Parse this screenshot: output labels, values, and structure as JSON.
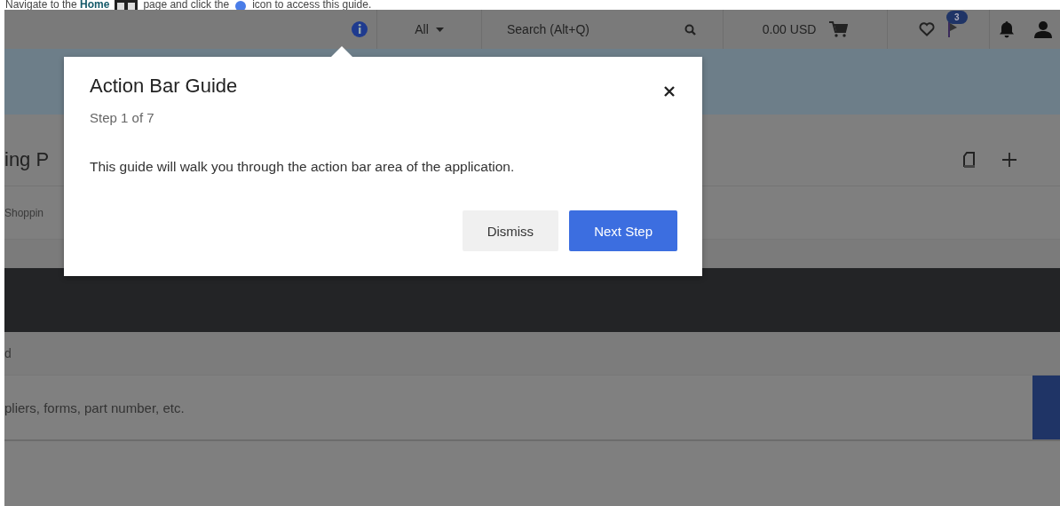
{
  "instruction": {
    "before": "Navigate to the **Home**",
    "middle": "page and click the",
    "after": "icon to access this guide."
  },
  "top_bar": {
    "scope": "All",
    "search_placeholder": "Search (Alt+Q)",
    "cart_total": "0.00 USD",
    "flag_badge": "3"
  },
  "page": {
    "title": "ing P",
    "breadcrumb": "Shoppin",
    "section_label": "d",
    "search_placeholder": "pliers, forms, part number, etc."
  },
  "guide": {
    "title": "Action Bar Guide",
    "step": "Step 1 of 7",
    "body": "This guide will walk you through the action bar area of the application.",
    "buttons": [
      {
        "label": "Dismiss",
        "kind": "secondary"
      },
      {
        "label": "Next Step",
        "kind": "primary"
      }
    ]
  }
}
